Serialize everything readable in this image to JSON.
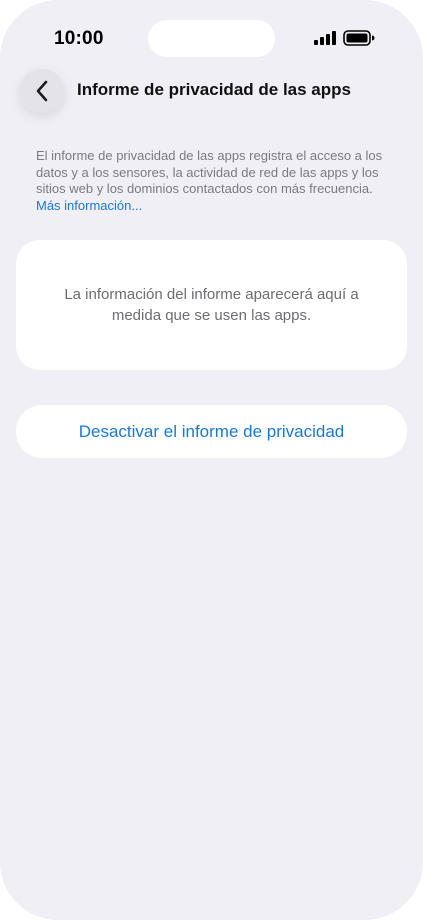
{
  "status_bar": {
    "time": "10:00",
    "signal_icon": "cellular-signal-icon",
    "battery_icon": "battery-icon"
  },
  "nav": {
    "back_icon": "chevron-left-icon",
    "title": "Informe de privacidad de las apps"
  },
  "description": {
    "text": "El informe de privacidad de las apps registra el acceso a los datos y a los sensores, la actividad de red de las apps y los sitios web y los dominios contactados con más frecuencia. ",
    "link": "Más información..."
  },
  "info_card": {
    "text": "La información del informe aparecerá aquí a medida que se usen las apps."
  },
  "actions": {
    "disable_label": "Desactivar el informe de privacidad"
  },
  "colors": {
    "background": "#f0eff5",
    "card": "#ffffff",
    "accent": "#1a78d6",
    "secondary_text": "#7a7a80"
  }
}
